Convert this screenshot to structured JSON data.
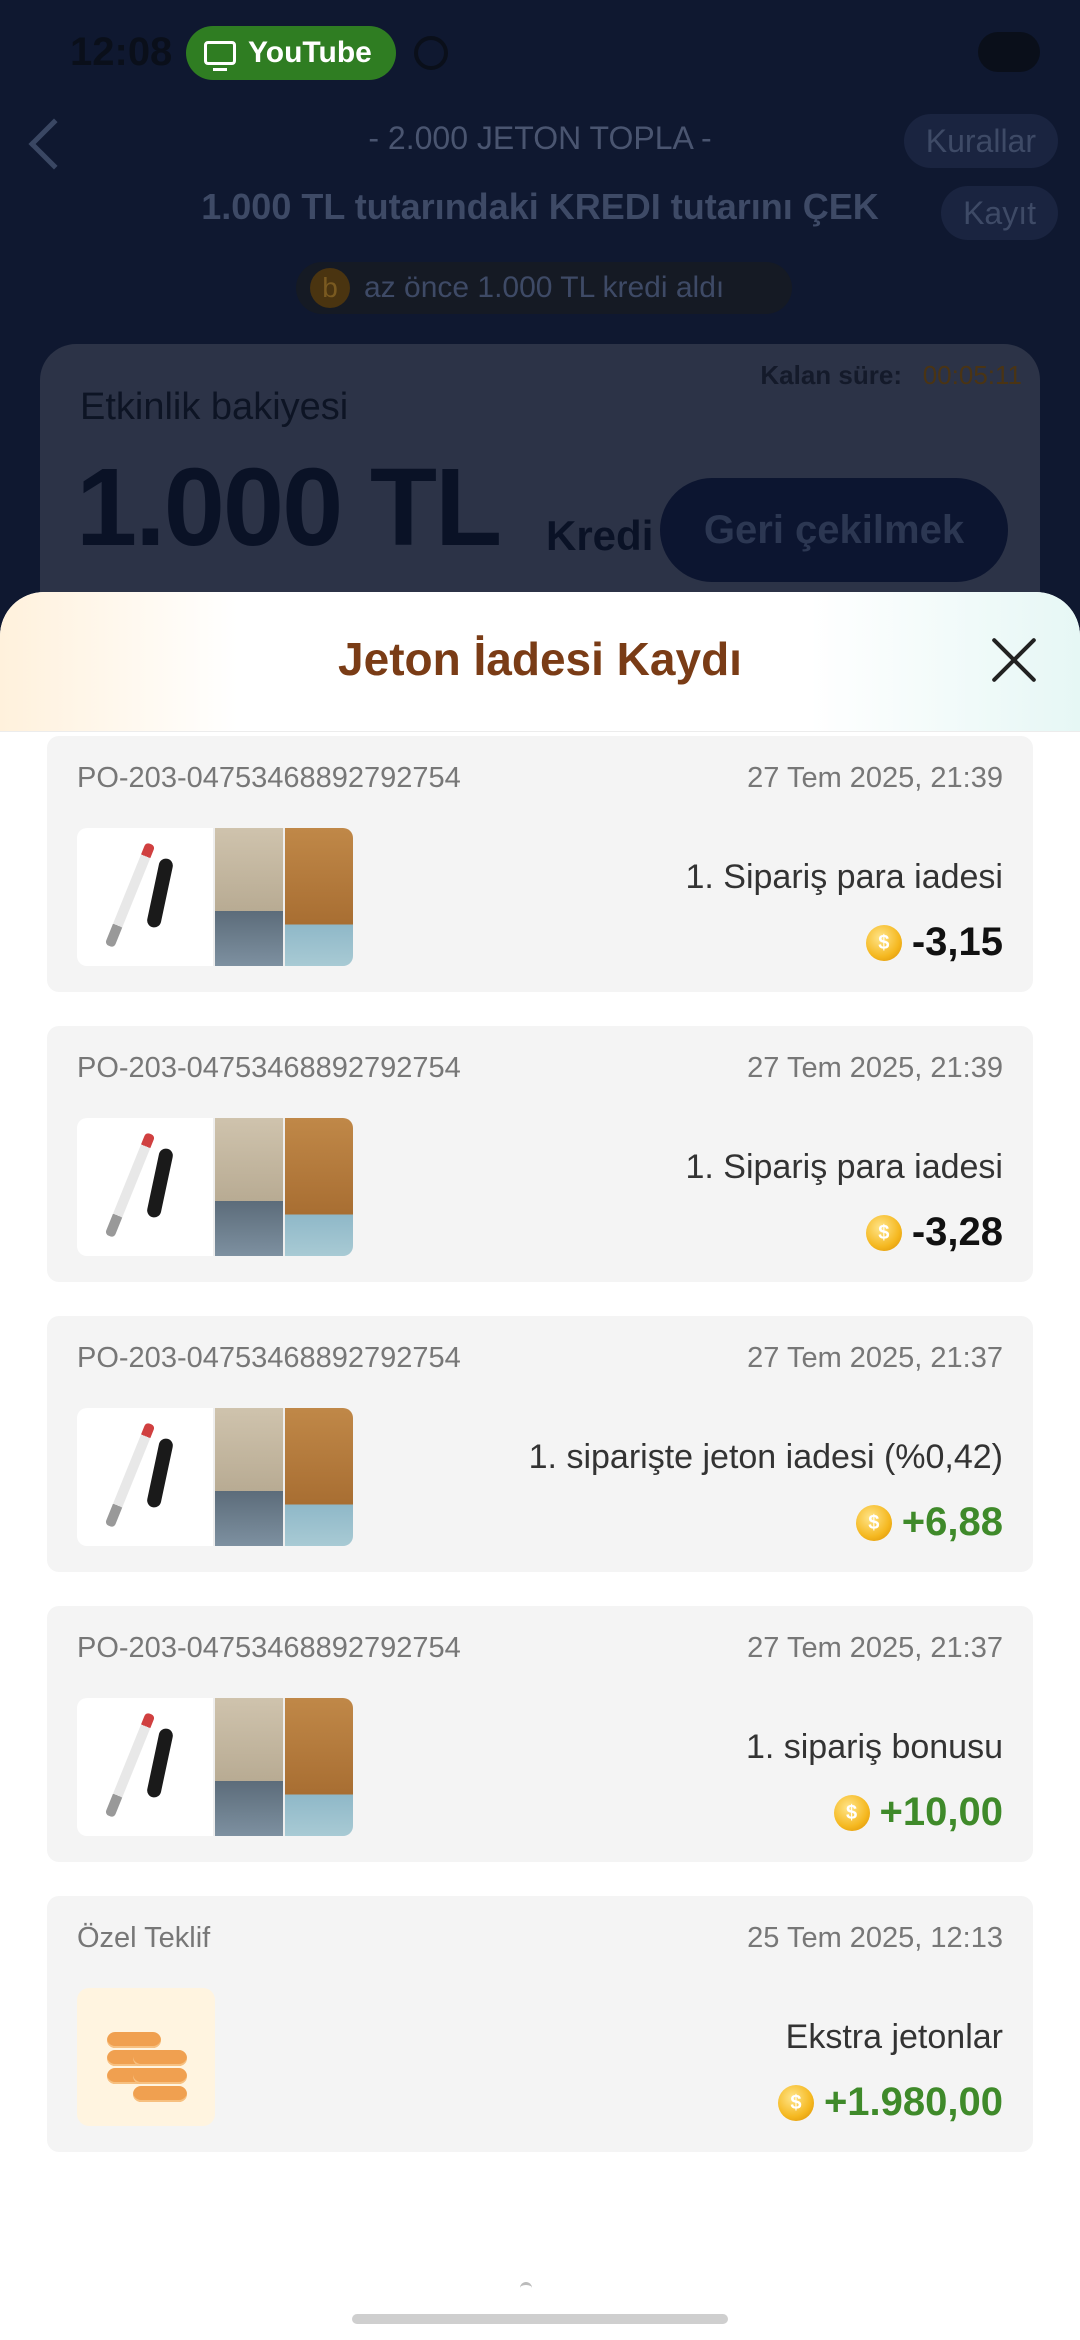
{
  "status_bar": {
    "time": "12:08",
    "youtube_label": "YouTube"
  },
  "page": {
    "subtitle": "- 2.000 JETON TOPLA -",
    "title": "1.000 TL tutarındaki KREDI tutarını ÇEK",
    "rules_label": "Kurallar",
    "log_label": "Kayıt",
    "ticker_badge": "b",
    "ticker_text": "az önce 1.000 TL kredi aldı",
    "remaining_label": "Kalan süre:",
    "remaining_value": "00:05:11",
    "balance_label": "Etkinlik bakiyesi",
    "balance_amount": "1.000 TL",
    "balance_unit": "Kredi",
    "withdraw_label": "Geri çekilmek"
  },
  "sheet": {
    "title": "Jeton İadesi Kaydı",
    "records": [
      {
        "id": "PO-203-04753468892792754",
        "date": "27 Tem 2025, 21:39",
        "description": "1. Sipariş para iadesi",
        "amount": "-3,15",
        "positive": false
      },
      {
        "id": "PO-203-04753468892792754",
        "date": "27 Tem 2025, 21:39",
        "description": "1. Sipariş para iadesi",
        "amount": "-3,28",
        "positive": false
      },
      {
        "id": "PO-203-04753468892792754",
        "date": "27 Tem 2025, 21:37",
        "description": "1. siparişte jeton iadesi (%0,42)",
        "amount": "+6,88",
        "positive": true
      },
      {
        "id": "PO-203-04753468892792754",
        "date": "27 Tem 2025, 21:37",
        "description": "1. sipariş bonusu",
        "amount": "+10,00",
        "positive": true
      },
      {
        "id": "Özel Teklif",
        "date": "25 Tem 2025, 12:13",
        "description": "Ekstra jetonlar",
        "amount": "+1.980,00",
        "positive": true
      }
    ],
    "coin_symbol": "$"
  },
  "colors": {
    "title_brown": "#7a3c16",
    "positive_green": "#3f8a2a",
    "coin_gold": "#f5b820"
  }
}
